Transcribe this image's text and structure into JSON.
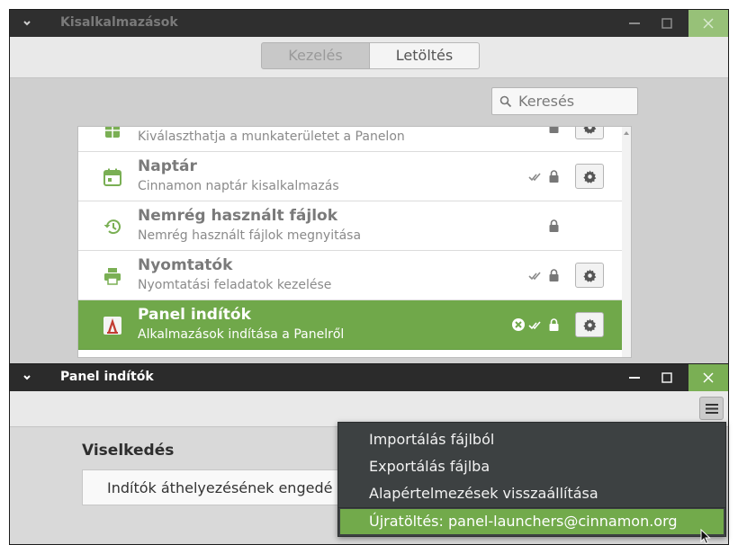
{
  "back_window": {
    "title": "Kisalkalmazások",
    "tabs": [
      "Kezelés",
      "Letöltés"
    ],
    "search_placeholder": "Keresés",
    "applets": [
      {
        "name": "",
        "description": "Kiválaszthatja a munkaterületet a Panelon",
        "icon": "workspace-icon",
        "checked": false,
        "locked": true,
        "settings": true
      },
      {
        "name": "Naptár",
        "description": "Cinnamon naptár kisalkalmazás",
        "icon": "calendar-icon",
        "checked": true,
        "locked": true,
        "settings": true
      },
      {
        "name": "Nemrég használt fájlok",
        "description": "Nemrég használt fájlok megnyitása",
        "icon": "history-icon",
        "checked": false,
        "locked": true,
        "settings": false
      },
      {
        "name": "Nyomtatók",
        "description": "Nyomtatási feladatok kezelése",
        "icon": "printer-icon",
        "checked": true,
        "locked": true,
        "settings": true
      },
      {
        "name": "Panel indítók",
        "description": "Alkalmazások indítása a Panelről",
        "icon": "panel-launcher-icon",
        "checked": true,
        "locked": true,
        "settings": true,
        "selected": true
      }
    ]
  },
  "front_window": {
    "title": "Panel indítók",
    "section_title": "Viselkedés",
    "setting_label": "Indítók áthelyezésének engedé"
  },
  "menu": {
    "items": [
      "Importálás fájlból",
      "Exportálás fájlba",
      "Alapértelmezések visszaállítása"
    ],
    "reload": "Újratöltés: panel-launchers@cinnamon.org"
  },
  "colors": {
    "accent": "#70a84a",
    "titlebar": "#2b2b2b",
    "menu_bg": "#3d4142"
  }
}
